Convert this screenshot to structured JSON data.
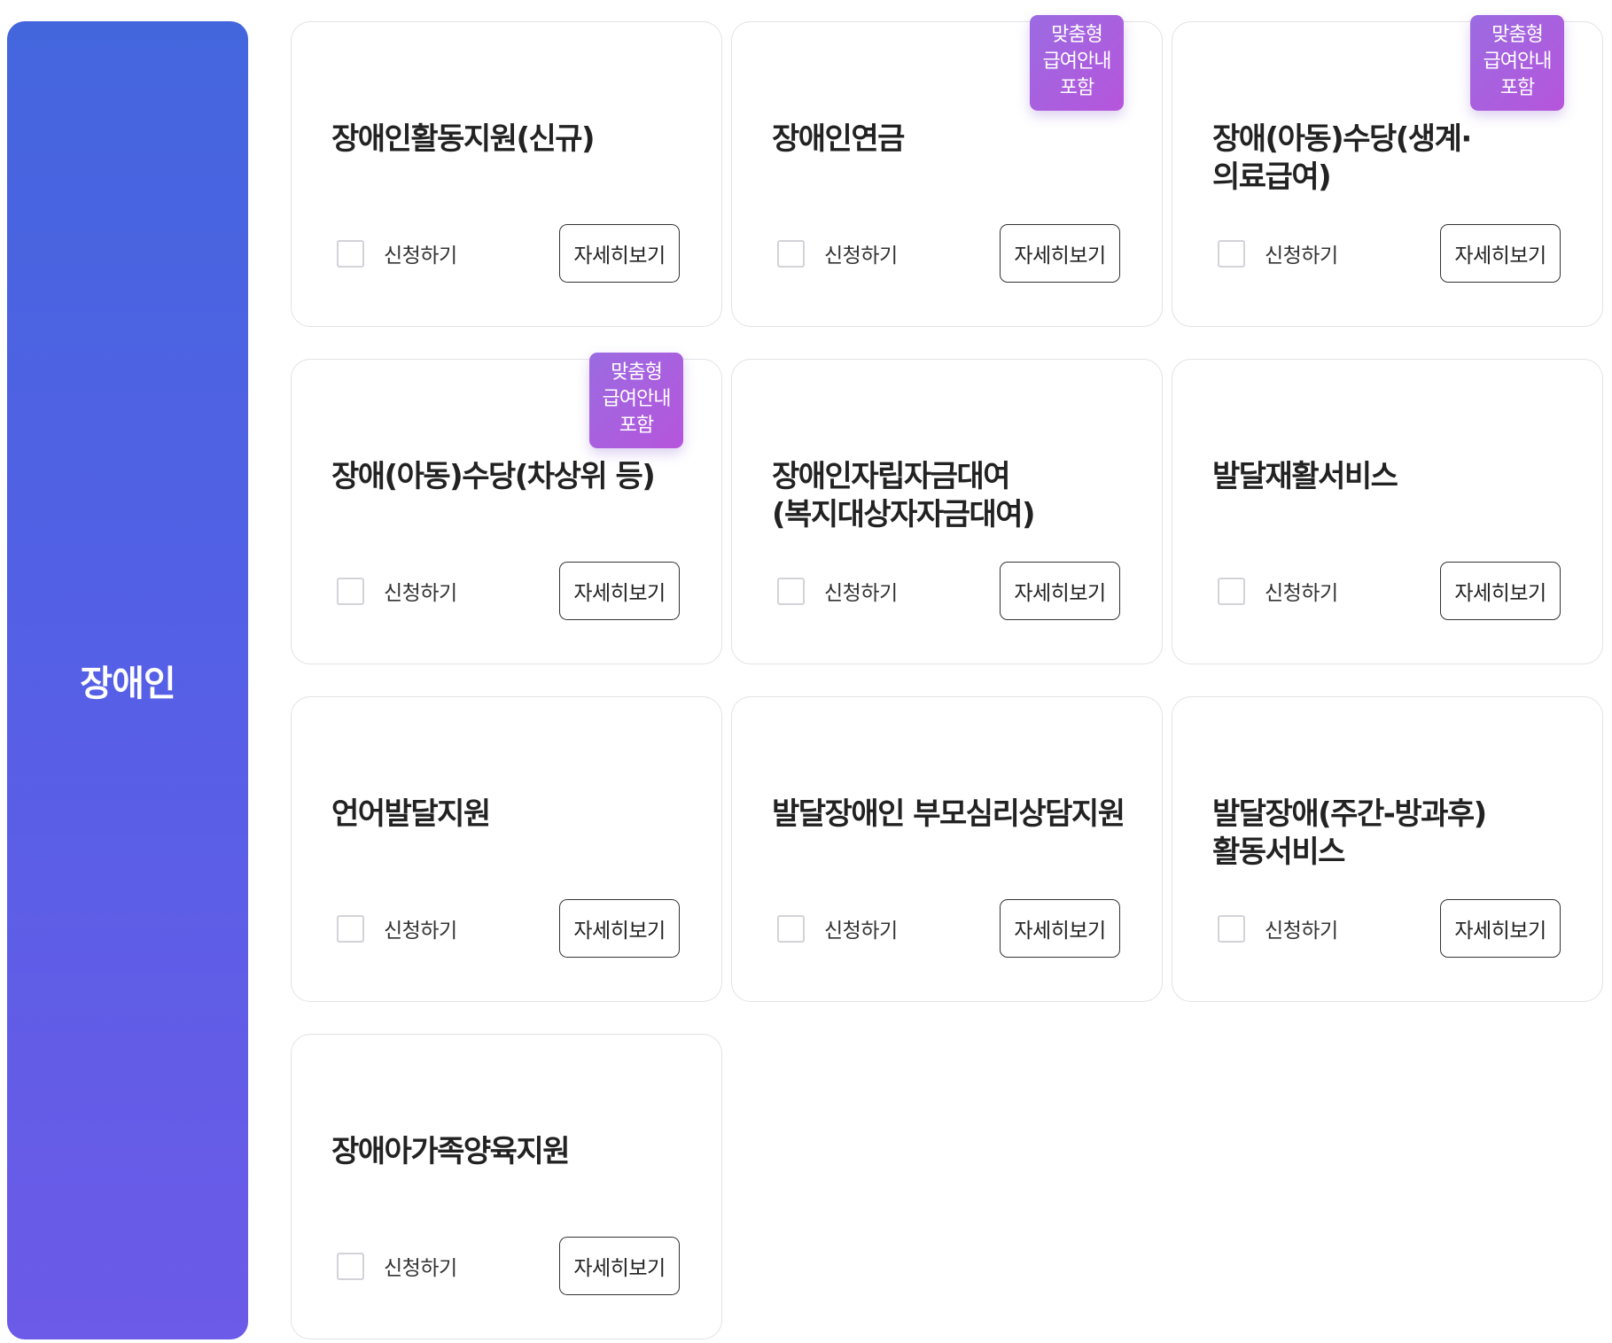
{
  "category": {
    "title": "장애인"
  },
  "cards": [
    {
      "title": "장애인활동지원(신규)",
      "badge": null,
      "apply_label": "신청하기",
      "detail_label": "자세히보기"
    },
    {
      "title": "장애인연금",
      "badge": [
        "맞춤형",
        "급여안내",
        "포함"
      ],
      "apply_label": "신청하기",
      "detail_label": "자세히보기"
    },
    {
      "title": "장애(아동)수당(생계·의료급여)",
      "badge": [
        "맞춤형",
        "급여안내",
        "포함"
      ],
      "apply_label": "신청하기",
      "detail_label": "자세히보기"
    },
    {
      "title": "장애(아동)수당(차상위 등)",
      "badge": [
        "맞춤형",
        "급여안내",
        "포함"
      ],
      "apply_label": "신청하기",
      "detail_label": "자세히보기"
    },
    {
      "title": "장애인자립자금대여(복지대상자자금대여)",
      "badge": null,
      "apply_label": "신청하기",
      "detail_label": "자세히보기"
    },
    {
      "title": "발달재활서비스",
      "badge": null,
      "apply_label": "신청하기",
      "detail_label": "자세히보기"
    },
    {
      "title": "언어발달지원",
      "badge": null,
      "apply_label": "신청하기",
      "detail_label": "자세히보기"
    },
    {
      "title": "발달장애인 부모심리상담지원",
      "badge": null,
      "apply_label": "신청하기",
      "detail_label": "자세히보기"
    },
    {
      "title": "발달장애(주간-방과후)활동서비스",
      "badge": null,
      "apply_label": "신청하기",
      "detail_label": "자세히보기"
    },
    {
      "title": "장애아가족양육지원",
      "badge": null,
      "apply_label": "신청하기",
      "detail_label": "자세히보기"
    }
  ],
  "colors": {
    "panel_gradient_top": "#4466dd",
    "panel_gradient_bottom": "#6c5ae8",
    "badge_gradient_start": "#9b6be2",
    "badge_gradient_end": "#b655dc",
    "card_border": "#e3e3e8",
    "button_border": "#333333"
  },
  "icons": {
    "checkbox": "empty-checkbox"
  }
}
